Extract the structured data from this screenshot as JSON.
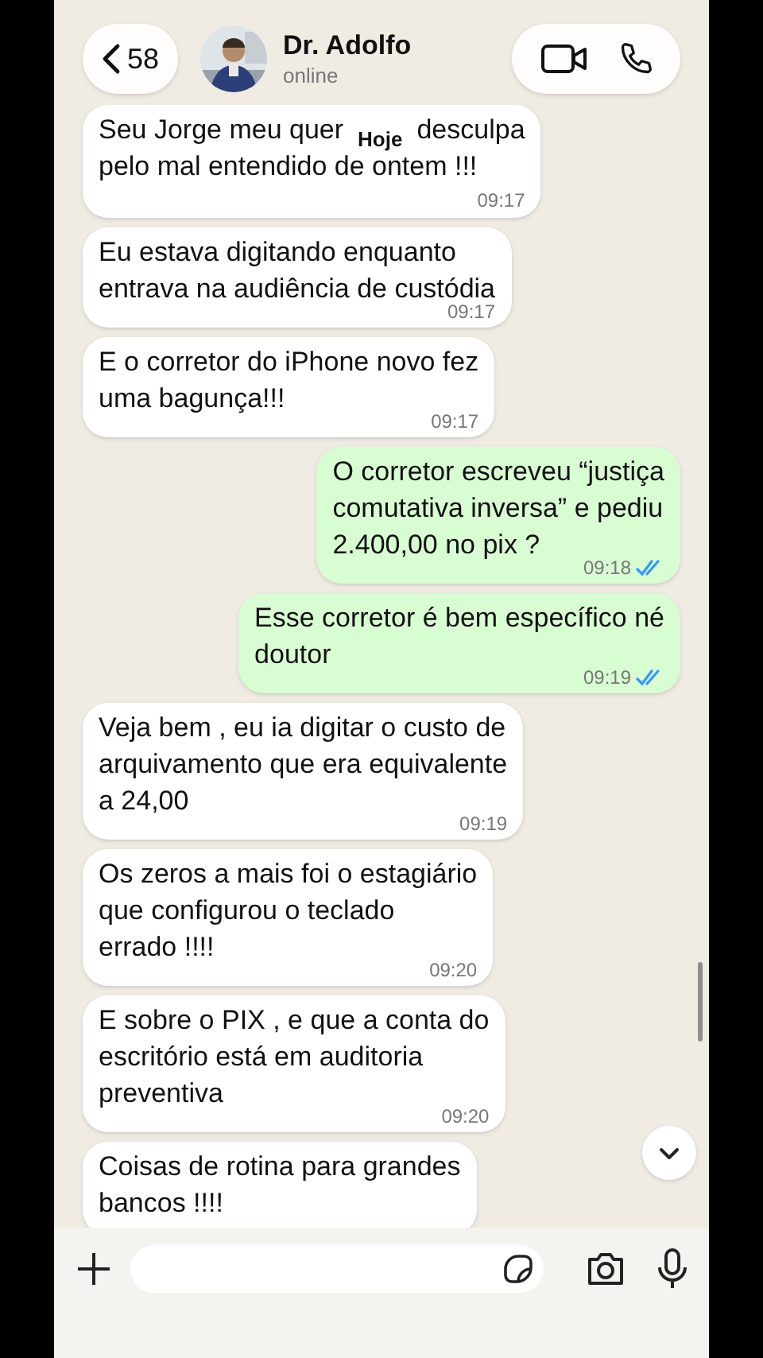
{
  "header": {
    "back_count": "58",
    "contact_name": "Dr. Adolfo",
    "contact_status": "online"
  },
  "date_label": "Hoje",
  "messages": [
    {
      "kind": "covered",
      "outgoing": false,
      "text_start": "Seu Jorge meu quer",
      "text_end": "desculpa\npelo mal entendido de ontem !!!",
      "time": "09:17"
    },
    {
      "kind": "text",
      "outgoing": false,
      "text": "Eu estava digitando enquanto\nentrava na audiência de custódia",
      "time": "09:17"
    },
    {
      "kind": "text",
      "outgoing": false,
      "text": "E o corretor do iPhone novo fez\numa bagunça!!!",
      "time": "09:17"
    },
    {
      "kind": "text",
      "outgoing": true,
      "text": "O corretor escreveu “justiça\ncomutativa inversa” e pediu\n2.400,00 no pix ?",
      "time": "09:18",
      "read": true
    },
    {
      "kind": "text",
      "outgoing": true,
      "text": "Esse corretor é bem específico né\ndoutor",
      "time": "09:19",
      "read": true
    },
    {
      "kind": "text",
      "outgoing": false,
      "text": "Veja bem , eu ia digitar o custo de\narquivamento que era equivalente\na 24,00",
      "time": "09:19"
    },
    {
      "kind": "text",
      "outgoing": false,
      "text": "Os zeros a mais foi o estagiário\nque configurou o teclado\nerrado !!!!",
      "time": "09:20"
    },
    {
      "kind": "text",
      "outgoing": false,
      "text": "E sobre o PIX , e que a conta do\nescritório está em auditoria\npreventiva",
      "time": "09:20"
    },
    {
      "kind": "text",
      "outgoing": false,
      "text": "Coisas de rotina para grandes\nbancos !!!!"
    }
  ]
}
